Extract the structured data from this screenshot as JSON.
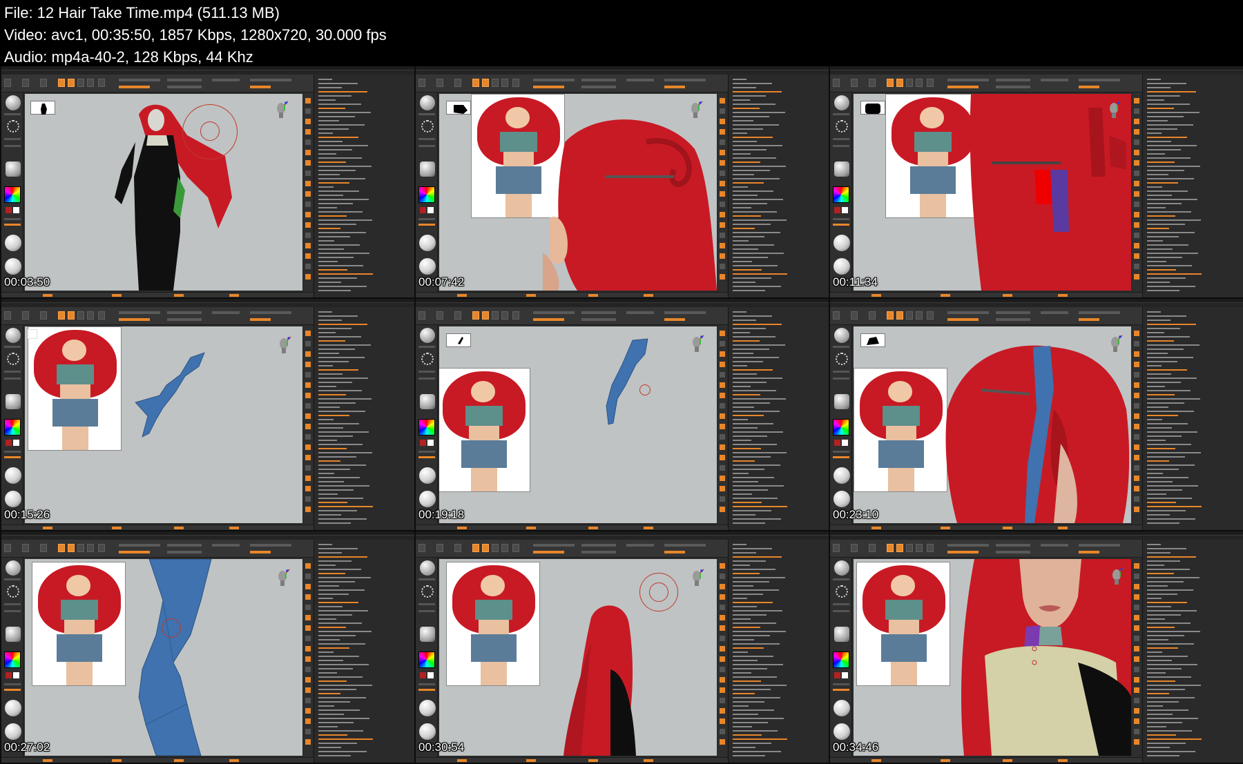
{
  "header": {
    "file_line": "File: 12  Hair Take Time.mp4 (511.13 MB)",
    "video_line": "Video: avc1, 00:35:50, 1857 Kbps, 1280x720, 30.000 fps",
    "audio_line": "Audio: mp4a-40-2, 128 Kbps, 44 Khz"
  },
  "thumbnails": [
    {
      "timestamp": "00:03:50",
      "scene": "full-figure"
    },
    {
      "timestamp": "00:07:42",
      "scene": "hair-closeup"
    },
    {
      "timestamp": "00:11:34",
      "scene": "hair-closeup-2"
    },
    {
      "timestamp": "00:15:26",
      "scene": "blue-strip"
    },
    {
      "timestamp": "00:19:18",
      "scene": "blue-strip-2"
    },
    {
      "timestamp": "00:23:10",
      "scene": "hair-blue"
    },
    {
      "timestamp": "00:27:02",
      "scene": "blue-zoom"
    },
    {
      "timestamp": "00:30:54",
      "scene": "hair-back"
    },
    {
      "timestamp": "00:34:46",
      "scene": "face-closeup"
    }
  ],
  "colors": {
    "accent": "#e8862a",
    "hair": "#c81a24",
    "strip": "#3f72ae",
    "canvas": "#bfc3c4"
  },
  "icons": [
    "zbrush-sphere-icon",
    "dots-brush-icon",
    "color-picker-icon",
    "material-sphere-icon",
    "navigation-head-icon",
    "axis-gizmo-icon"
  ]
}
